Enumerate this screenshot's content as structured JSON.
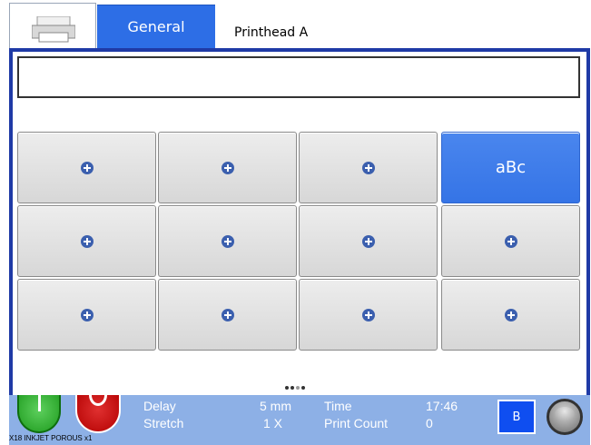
{
  "tabs": {
    "printer_icon": "printer-icon",
    "general": "General",
    "printhead": "Printhead A"
  },
  "editor": {
    "text_value": "",
    "active_cell_label": "aBc",
    "add_icon": "plus-circle-icon"
  },
  "pager": {
    "pages": 4,
    "current": 3
  },
  "status": {
    "delay_label": "Delay",
    "delay_value": "5 mm",
    "stretch_label": "Stretch",
    "stretch_value": "1 X",
    "time_label": "Time",
    "time_value": "17:46",
    "count_label": "Print Count",
    "count_value": "0",
    "b_button": "B",
    "ink_info": "X18 INKJET POROUS x1"
  },
  "colors": {
    "accent": "#2d6ee6",
    "frame": "#1f3aa6",
    "statusbar": "#8db0e6",
    "go": "#1d9a1d",
    "stop": "#b30000"
  }
}
